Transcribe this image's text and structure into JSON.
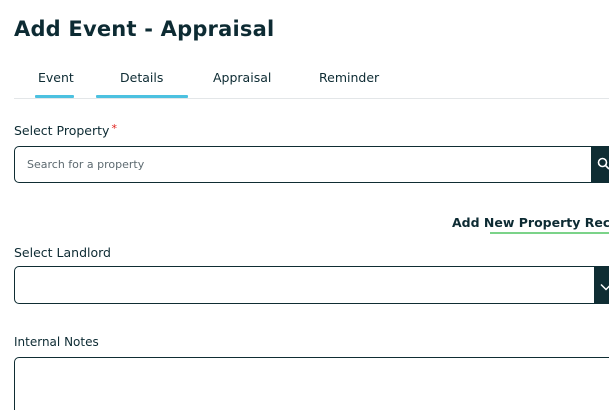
{
  "page": {
    "title": "Add Event - Appraisal"
  },
  "tabs": [
    {
      "label": "Event",
      "active": false
    },
    {
      "label": "Details",
      "active": true
    },
    {
      "label": "Appraisal",
      "active": false
    },
    {
      "label": "Reminder",
      "active": false
    }
  ],
  "property": {
    "label": "Select Property",
    "required_mark": "*",
    "placeholder": "Search for a property",
    "value": "",
    "button_icon": "search-icon",
    "add_link": "Add New Property Record"
  },
  "landlord": {
    "label": "Select Landlord",
    "selected": "",
    "button_icon": "chevron-down-icon"
  },
  "notes": {
    "label": "Internal Notes",
    "value": ""
  },
  "colors": {
    "text": "#0d2b33",
    "border": "#0f2d33",
    "tab_active_underline": "#4cc1e0",
    "link_underline": "#7bd389",
    "required": "#e0201b"
  }
}
